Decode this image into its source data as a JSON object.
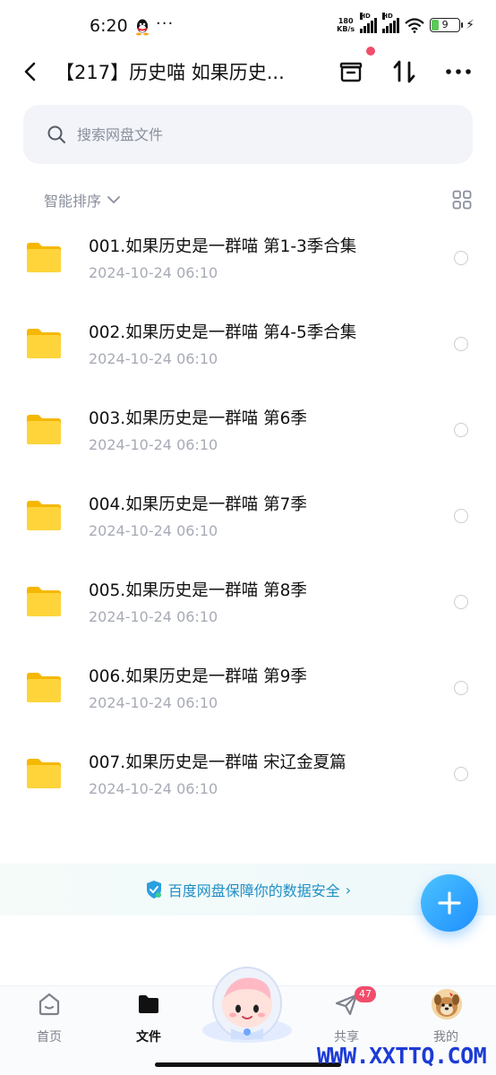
{
  "status_bar": {
    "time": "6:20",
    "dots": "···",
    "speed": "180",
    "speed_unit": "KB/s",
    "signal_label": "HD",
    "battery": "9"
  },
  "header": {
    "title": "【217】历史喵 如果历史...",
    "archive_icon": "archive-box-icon",
    "sort_icon": "transfer-icon",
    "more_icon": "more-icon"
  },
  "search": {
    "placeholder": "搜索网盘文件"
  },
  "sort": {
    "label": "智能排序"
  },
  "files": [
    {
      "name": "001.如果历史是一群喵 第1-3季合集",
      "date": "2024-10-24 06:10"
    },
    {
      "name": "002.如果历史是一群喵 第4-5季合集",
      "date": "2024-10-24 06:10"
    },
    {
      "name": "003.如果历史是一群喵 第6季",
      "date": "2024-10-24 06:10"
    },
    {
      "name": "004.如果历史是一群喵 第7季",
      "date": "2024-10-24 06:10"
    },
    {
      "name": "005.如果历史是一群喵 第8季",
      "date": "2024-10-24 06:10"
    },
    {
      "name": "006.如果历史是一群喵 第9季",
      "date": "2024-10-24 06:10"
    },
    {
      "name": "007.如果历史是一群喵 宋辽金夏篇",
      "date": "2024-10-24 06:10"
    }
  ],
  "banner": {
    "text": "百度网盘保障你的数据安全",
    "chevron": "›"
  },
  "nav": {
    "home": "首页",
    "files": "文件",
    "share": "共享",
    "share_badge": "47",
    "me": "我的"
  },
  "watermark": "WWW.XXTTQ.COM",
  "colors": {
    "accent": "#1e8fff",
    "folder": "#ffcb2b",
    "badge": "#f24e6b",
    "banner_text": "#1f8fc5"
  }
}
